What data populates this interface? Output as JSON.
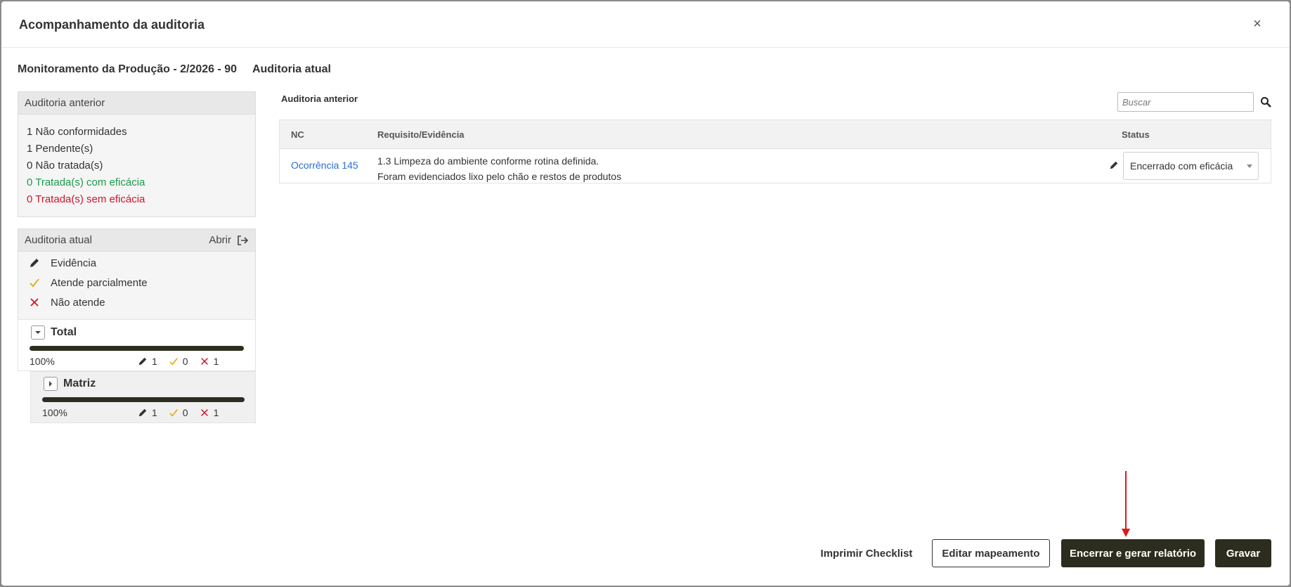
{
  "modal": {
    "title": "Acompanhamento da auditoria",
    "close_label": "×"
  },
  "subheader": {
    "process": "Monitoramento da Produção - 2/2026 - 90",
    "current": "Auditoria atual"
  },
  "previous_panel": {
    "title": "Auditoria anterior",
    "stats": [
      "1 Não conformidades",
      "1 Pendente(s)",
      "0 Não tratada(s)",
      "0 Tratada(s) com eficácia",
      "0 Tratada(s) sem eficácia"
    ]
  },
  "current_panel": {
    "title": "Auditoria atual",
    "open_label": "Abrir",
    "legend": [
      {
        "icon": "pencil-icon",
        "label": "Evidência"
      },
      {
        "icon": "check-icon",
        "label": "Atende parcialmente"
      },
      {
        "icon": "x-icon",
        "label": "Não atende"
      }
    ]
  },
  "tree": {
    "total": {
      "label": "Total",
      "percent": "100%",
      "progress": 1.0,
      "evidence": "1",
      "partial": "0",
      "fail": "1"
    },
    "matriz": {
      "label": "Matriz",
      "percent": "100%",
      "progress": 1.0,
      "evidence": "1",
      "partial": "0",
      "fail": "1"
    }
  },
  "right": {
    "section_label": "Auditoria anterior",
    "search_placeholder": "Buscar",
    "table": {
      "headers": {
        "nc": "NC",
        "req": "Requisito/Evidência",
        "status": "Status"
      },
      "rows": [
        {
          "nc": "Ocorrência 145",
          "requirement": "1.3 Limpeza do ambiente conforme rotina definida.",
          "evidence": "Foram evidenciados lixo pelo chão e restos de produtos",
          "status": "Encerrado com eficácia"
        }
      ]
    }
  },
  "footer": {
    "print_label": "Imprimir Checklist",
    "edit_label": "Editar mapeamento",
    "close_report_label": "Encerrar e gerar relatório",
    "save_label": "Gravar"
  },
  "colors": {
    "accent": "#2d2d1f",
    "link": "#2a6fd1",
    "success": "#1a9a4a",
    "danger": "#d0152b",
    "warning": "#e0a800"
  }
}
